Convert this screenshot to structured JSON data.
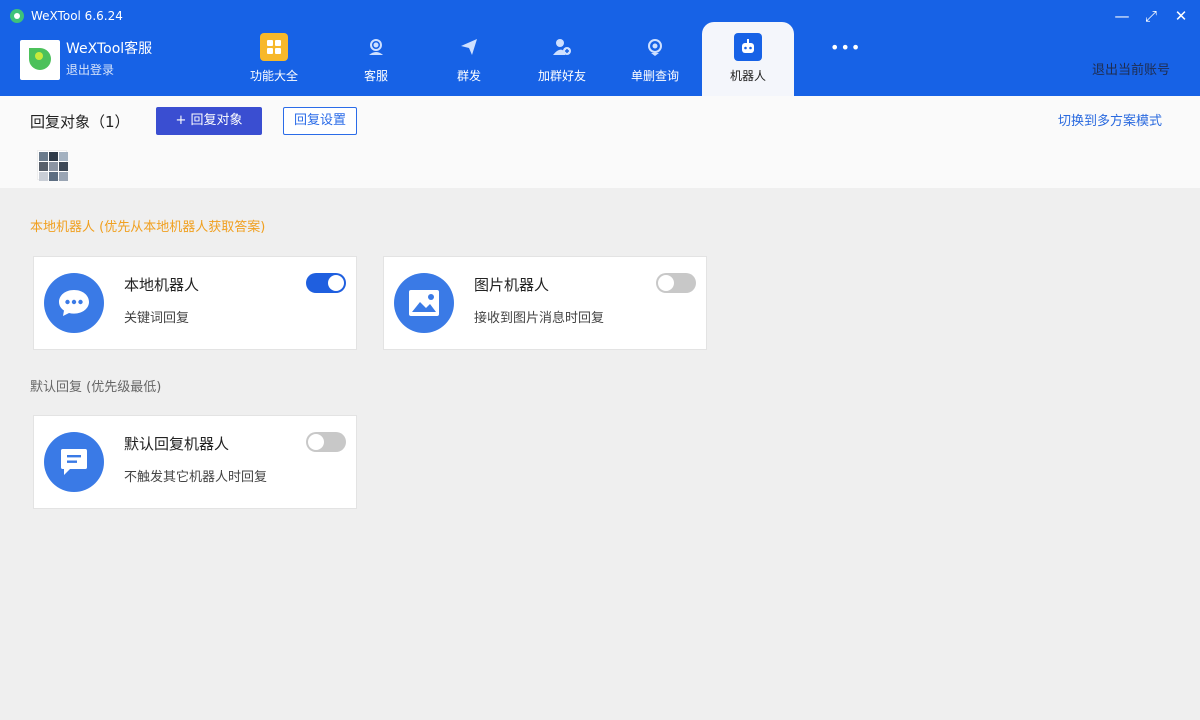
{
  "window": {
    "title": "WeXTool 6.6.24",
    "minimize_label": "—",
    "maximize_label": "⤢",
    "close_label": "✕"
  },
  "account": {
    "name": "WeXTool客服",
    "logout": "退出登录"
  },
  "tabs": [
    {
      "label": "功能大全",
      "icon": "grid-icon"
    },
    {
      "label": "客服",
      "icon": "customer-service-icon"
    },
    {
      "label": "群发",
      "icon": "send-icon"
    },
    {
      "label": "加群好友",
      "icon": "add-friend-icon"
    },
    {
      "label": "单删查询",
      "icon": "query-icon"
    },
    {
      "label": "机器人",
      "icon": "robot-icon",
      "active": true
    }
  ],
  "header": {
    "more_label": "•••",
    "logout_account": "退出当前账号"
  },
  "reply_target": {
    "title": "回复对象（1）",
    "add_button": "+ 回复对象",
    "settings_button": "回复设置",
    "switch_mode": "切换到多方案模式"
  },
  "sections": {
    "local_title": "本地机器人 (优先从本地机器人获取答案)",
    "default_title": "默认回复 (优先级最低)"
  },
  "cards": {
    "local": {
      "title": "本地机器人",
      "desc": "关键词回复",
      "enabled": true,
      "icon": "chat-bubble-icon"
    },
    "image": {
      "title": "图片机器人",
      "desc": "接收到图片消息时回复",
      "enabled": false,
      "icon": "image-icon"
    },
    "default": {
      "title": "默认回复机器人",
      "desc": "不触发其它机器人时回复",
      "enabled": false,
      "icon": "message-icon"
    }
  },
  "colors": {
    "header_bg": "#1762e6",
    "accent": "#3a4ed1",
    "link": "#2a6adf",
    "warning_title": "#f0a020",
    "toggle_on": "#1f5fdf",
    "toggle_off": "#c8c8c8",
    "card_icon": "#3a7ae6"
  }
}
